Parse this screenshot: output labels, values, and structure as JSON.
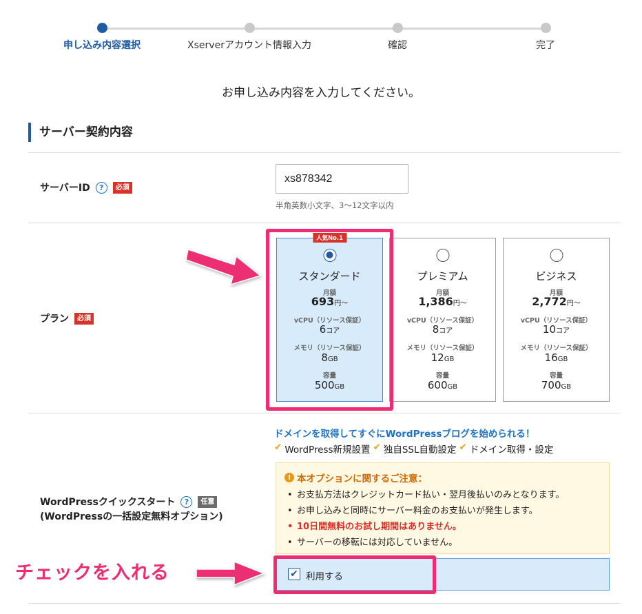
{
  "progress": {
    "steps": [
      {
        "label": "申し込み内容選択",
        "active": true
      },
      {
        "label": "Xserverアカウント情報入力",
        "active": false
      },
      {
        "label": "確認",
        "active": false
      },
      {
        "label": "完了",
        "active": false
      }
    ]
  },
  "intro_text": "お申し込み内容を入力してください。",
  "section_title": "サーバー契約内容",
  "server_id": {
    "label": "サーバーID",
    "help": "?",
    "required": "必須",
    "value": "xs878342",
    "hint": "半角英数小文字、3〜12文字以内"
  },
  "plan": {
    "label": "プラン",
    "required": "必須",
    "popular_badge": "人気No.1",
    "options": [
      {
        "name": "スタンダード",
        "price_label": "月額",
        "price": "693",
        "price_unit": "円〜",
        "cpu_label": "vCPU（リソース保証）",
        "cpu": "6",
        "cpu_unit": "コア",
        "mem_label": "メモリ（リソース保証）",
        "mem": "8",
        "mem_unit": "GB",
        "disk_label": "容量",
        "disk": "500",
        "disk_unit": "GB",
        "selected": true
      },
      {
        "name": "プレミアム",
        "price_label": "月額",
        "price": "1,386",
        "price_unit": "円〜",
        "cpu_label": "vCPU（リソース保証）",
        "cpu": "8",
        "cpu_unit": "コア",
        "mem_label": "メモリ（リソース保証）",
        "mem": "12",
        "mem_unit": "GB",
        "disk_label": "容量",
        "disk": "600",
        "disk_unit": "GB",
        "selected": false
      },
      {
        "name": "ビジネス",
        "price_label": "月額",
        "price": "2,772",
        "price_unit": "円〜",
        "cpu_label": "vCPU（リソース保証）",
        "cpu": "10",
        "cpu_unit": "コア",
        "mem_label": "メモリ（リソース保証）",
        "mem": "16",
        "mem_unit": "GB",
        "disk_label": "容量",
        "disk": "700",
        "disk_unit": "GB",
        "selected": false
      }
    ]
  },
  "wordpress": {
    "label": "WordPressクイックスタート",
    "help": "?",
    "optional": "任意",
    "sublabel": "(WordPressの一括設定無料オプション)",
    "headline": "ドメインを取得してすぐにWordPressブログを始められる！",
    "features": [
      "WordPress新規設置",
      "独自SSL自動設定",
      "ドメイン取得・設定"
    ],
    "feature_check": "✔",
    "notice_icon": "!",
    "notice_title": "本オプションに関するご注意：",
    "notice_items": [
      {
        "text": "お支払方法はクレジットカード払い・翌月後払いのみとなります。",
        "emphasis": false
      },
      {
        "text": "お申し込みと同時にサーバー料金のお支払いが発生します。",
        "emphasis": false
      },
      {
        "text": "10日間無料のお試し期間はありません。",
        "emphasis": true
      },
      {
        "text": "サーバーの移転には対応していません。",
        "emphasis": false
      }
    ],
    "use_label": "利用する",
    "use_checked": true,
    "check_mark": "✔"
  },
  "annotation": "チェックを入れる",
  "colors": {
    "accent": "#1f5aa3",
    "highlight": "#ec2d72",
    "required": "#d8322a"
  }
}
